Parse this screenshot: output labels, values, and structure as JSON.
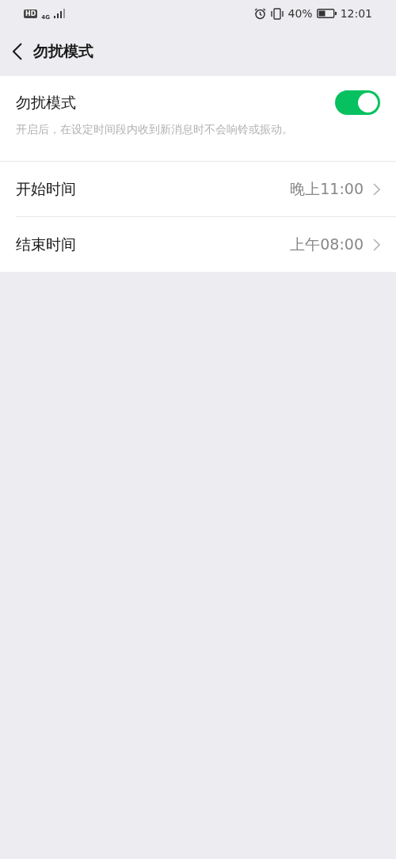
{
  "status_bar": {
    "hd_badge": "HD",
    "network": "4G",
    "battery_percent": "40%",
    "time": "12:01"
  },
  "header": {
    "title": "勿扰模式"
  },
  "toggle_row": {
    "label": "勿扰模式",
    "on": true,
    "description": "开启后，在设定时间段内收到新消息时不会响铃或振动。"
  },
  "time_rows": [
    {
      "label": "开始时间",
      "value": "晚上11:00"
    },
    {
      "label": "结束时间",
      "value": "上午08:00"
    }
  ]
}
